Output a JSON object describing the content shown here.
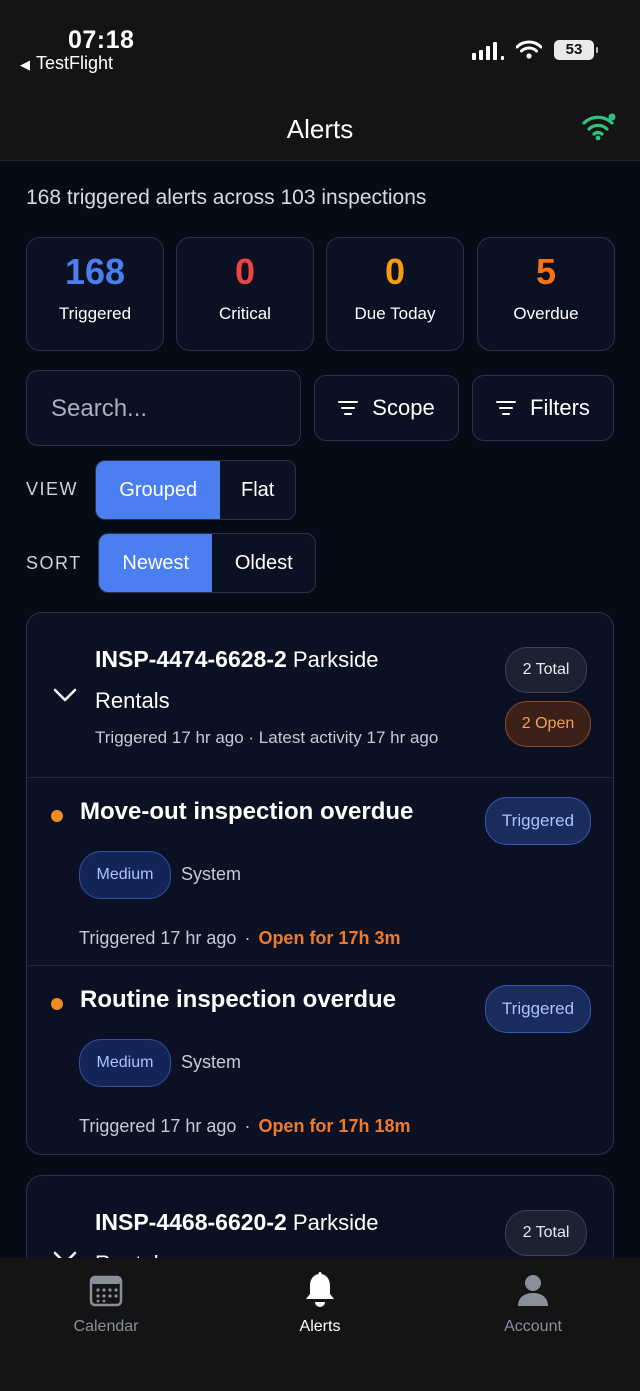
{
  "status_bar": {
    "time": "07:18",
    "back_label": "TestFlight",
    "battery": "53"
  },
  "header": {
    "title": "Alerts"
  },
  "summary": "168 triggered alerts across 103 inspections",
  "stats": [
    {
      "value": "168",
      "label": "Triggered",
      "color": "#4b7ef0"
    },
    {
      "value": "0",
      "label": "Critical",
      "color": "#ef4444"
    },
    {
      "value": "0",
      "label": "Due Today",
      "color": "#f59e0b"
    },
    {
      "value": "5",
      "label": "Overdue",
      "color": "#f97316"
    }
  ],
  "search": {
    "placeholder": "Search..."
  },
  "buttons": {
    "scope": "Scope",
    "filters": "Filters"
  },
  "view": {
    "label": "VIEW",
    "options": [
      "Grouped",
      "Flat"
    ],
    "selected": "Grouped"
  },
  "sort": {
    "label": "SORT",
    "options": [
      "Newest",
      "Oldest"
    ],
    "selected": "Newest"
  },
  "groups": [
    {
      "id": "INSP-4474-6628-2",
      "name_a": "Parkside",
      "name_b": "Rentals",
      "meta": "Triggered 17 hr ago · Latest activity 17 hr ago",
      "total": "2 Total",
      "open": "2 Open",
      "alerts": [
        {
          "title": "Move-out inspection overdue",
          "status": "Triggered",
          "severity": "Medium",
          "source": "System",
          "triggered": "Triggered 17 hr ago",
          "sep": "·",
          "open_for": "Open for 17h 3m"
        },
        {
          "title": "Routine inspection overdue",
          "status": "Triggered",
          "severity": "Medium",
          "source": "System",
          "triggered": "Triggered 17 hr ago",
          "sep": "·",
          "open_for": "Open for 17h 18m"
        }
      ]
    },
    {
      "id": "INSP-4468-6620-2",
      "name_a": "Parkside",
      "name_b": "Rentals",
      "total": "2 Total"
    }
  ],
  "tabs": [
    {
      "label": "Calendar",
      "icon": "calendar-icon",
      "active": false
    },
    {
      "label": "Alerts",
      "icon": "bell-icon",
      "active": true
    },
    {
      "label": "Account",
      "icon": "person-icon",
      "active": false
    }
  ]
}
